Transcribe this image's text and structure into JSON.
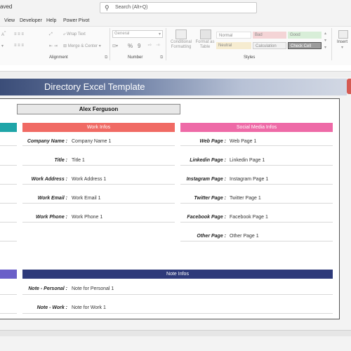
{
  "titlebar": {
    "saved_text": "aved",
    "search_placeholder": "Search (Alt+Q)"
  },
  "tabs": [
    "View",
    "Developer",
    "Help",
    "Power Pivot"
  ],
  "ribbon": {
    "wrap_text": "Wrap Text",
    "merge_center": "Merge & Center",
    "number_format": "General",
    "percent": "%",
    "comma": "9",
    "conditional_formatting": [
      "Conditional",
      "Formatting"
    ],
    "format_as_table": [
      "Format as",
      "Table"
    ],
    "styles": [
      "Normal",
      "Bad",
      "Good",
      "Neutral",
      "Calculation",
      "Check Cell"
    ],
    "insert": "Insert",
    "groups": {
      "alignment": "Alignment",
      "number": "Number",
      "styles": "Styles"
    }
  },
  "banner": {
    "title": "Directory Excel Template"
  },
  "contact": {
    "name": "Alex Ferguson"
  },
  "work": {
    "header": "Work Infos",
    "color": "#f06a64",
    "fields": [
      {
        "label": "Company Name :",
        "value": "Company Name 1"
      },
      {
        "label": "Title :",
        "value": "Title 1"
      },
      {
        "label": "Work Address :",
        "value": "Work Address 1"
      },
      {
        "label": "Work Email :",
        "value": "Work Email 1"
      },
      {
        "label": "Work Phone :",
        "value": "Work Phone 1"
      }
    ]
  },
  "social": {
    "header": "Social Media Infos",
    "color": "#ee6aa7",
    "fields": [
      {
        "label": "Web Page :",
        "value": "Web Page 1"
      },
      {
        "label": "Linkedin Page :",
        "value": "Linkedin Page 1"
      },
      {
        "label": "Instagram Page :",
        "value": "Instagram Page 1"
      },
      {
        "label": "Twitter Page :",
        "value": "Twitter Page 1"
      },
      {
        "label": "Facebook Page :",
        "value": "Facebook Page 1"
      },
      {
        "label": "Other Page :",
        "value": "Other Page 1"
      }
    ]
  },
  "notes": {
    "header": "Note Infos",
    "color": "#2e3a7a",
    "fields": [
      {
        "label": "Note - Personal :",
        "value": "Note for Personal 1"
      },
      {
        "label": "Note - Work :",
        "value": "Note for Work 1"
      }
    ]
  },
  "colors": {
    "left_teal": "#1fa5a8",
    "left_purple": "#6a5fc8"
  }
}
